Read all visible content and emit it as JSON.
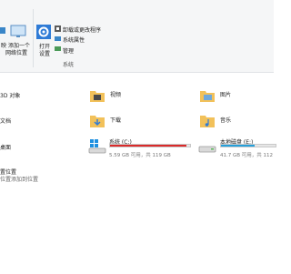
{
  "ribbon": {
    "left_item_1": "映",
    "left_item_2": "添加一个",
    "left_item_3": "网络位置",
    "open_settings_1": "打开",
    "open_settings_2": "设置",
    "uninstall": "卸载或更改程序",
    "system_properties": "系统属性",
    "manage": "管理",
    "group_system": "系统"
  },
  "sidebar_sections": {
    "objects_3d": "3D 对象",
    "documents": "文档",
    "desktop": "桌面",
    "location": "置位置",
    "location_sub": "位置添加到位置"
  },
  "libraries": {
    "videos": "视频",
    "pictures": "图片",
    "downloads": "下载",
    "music": "音乐"
  },
  "drives": [
    {
      "name": "系统 (C:)",
      "free": "5.59 GB 可用，共 119 GB",
      "used_fraction": 0.95,
      "bar_color": "#da2a2a"
    },
    {
      "name": "本地磁盘 (E:)",
      "free": "41.7 GB 可用，共 112",
      "used_fraction": 0.62,
      "bar_color": "#26a0da"
    }
  ]
}
